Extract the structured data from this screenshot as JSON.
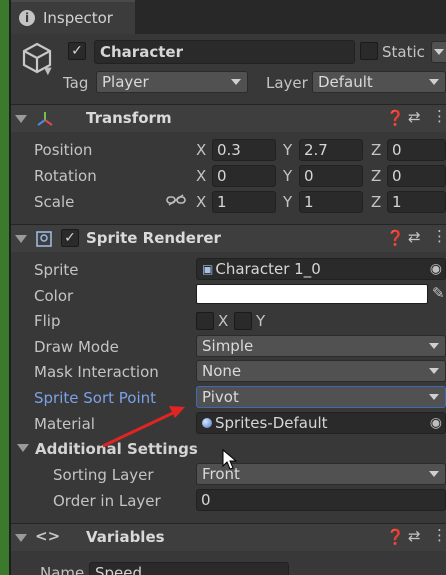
{
  "tab": {
    "title": "Inspector",
    "icon": "info-icon"
  },
  "object": {
    "active": true,
    "name": "Character",
    "static_label": "Static",
    "tag_label": "Tag",
    "tag_value": "Player",
    "layer_label": "Layer",
    "layer_value": "Default"
  },
  "transform": {
    "title": "Transform",
    "rows": [
      {
        "label": "Position",
        "x": "0.3",
        "y": "2.7",
        "z": "0"
      },
      {
        "label": "Rotation",
        "x": "0",
        "y": "0",
        "z": "0"
      },
      {
        "label": "Scale",
        "x": "1",
        "y": "1",
        "z": "1"
      }
    ],
    "axis": {
      "x": "X",
      "y": "Y",
      "z": "Z"
    }
  },
  "sprite_renderer": {
    "title": "Sprite Renderer",
    "enabled": true,
    "sprite_label": "Sprite",
    "sprite_value": "Character 1_0",
    "color_label": "Color",
    "color_value": "#ffffff",
    "flip_label": "Flip",
    "flip_x": "X",
    "flip_y": "Y",
    "draw_mode_label": "Draw Mode",
    "draw_mode_value": "Simple",
    "mask_label": "Mask Interaction",
    "mask_value": "None",
    "sort_point_label": "Sprite Sort Point",
    "sort_point_value": "Pivot",
    "material_label": "Material",
    "material_value": "Sprites-Default",
    "additional_title": "Additional Settings",
    "sorting_layer_label": "Sorting Layer",
    "sorting_layer_value": "Front",
    "order_label": "Order in Layer",
    "order_value": "0"
  },
  "variables": {
    "title": "Variables",
    "name_label": "Name",
    "name_value": "Speed"
  },
  "colors": {
    "panel_bg": "#383838",
    "highlight_label": "#7aa2e8",
    "annotation_arrow": "#e02424"
  }
}
